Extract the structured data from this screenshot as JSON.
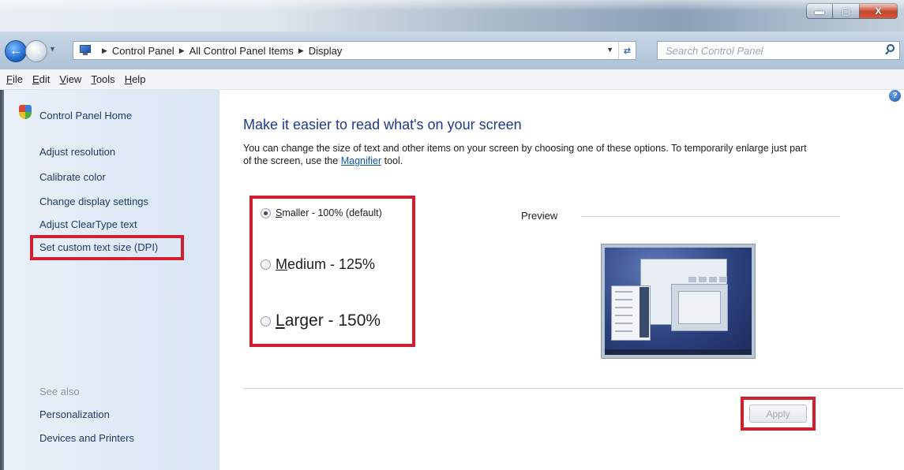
{
  "window": {
    "controls": {
      "minimize": "▬",
      "maximize": "▢",
      "close": "X"
    }
  },
  "navigation": {
    "back_icon": "back-arrow-icon",
    "forward_icon": "forward-arrow-icon",
    "breadcrumbs": [
      "Control Panel",
      "All Control Panel Items",
      "Display"
    ],
    "search_placeholder": "Search Control Panel"
  },
  "menu": [
    {
      "accel": "F",
      "rest": "ile"
    },
    {
      "accel": "E",
      "rest": "dit"
    },
    {
      "accel": "V",
      "rest": "iew"
    },
    {
      "accel": "T",
      "rest": "ools"
    },
    {
      "accel": "H",
      "rest": "elp"
    }
  ],
  "sidebar": {
    "home": "Control Panel Home",
    "links": [
      "Adjust resolution",
      "Calibrate color",
      "Change display settings",
      "Adjust ClearType text",
      "Set custom text size (DPI)"
    ],
    "see_also_title": "See also",
    "see_also": [
      "Personalization",
      "Devices and Printers"
    ]
  },
  "main": {
    "heading": "Make it easier to read what's on your screen",
    "description_before": "You can change the size of text and other items on your screen by choosing one of these options. To temporarily enlarge just part of the screen, use the ",
    "description_link": "Magnifier",
    "description_after": " tool.",
    "options": [
      {
        "accel": "S",
        "rest": "maller - 100% (default)",
        "checked": true
      },
      {
        "accel": "M",
        "rest": "edium - 125%",
        "checked": false
      },
      {
        "accel": "L",
        "rest": "arger - 150%",
        "checked": false
      }
    ],
    "preview_label": "Preview",
    "apply_label": "Apply"
  },
  "colors": {
    "highlight_box": "#d21f2f",
    "link": "#1e3c63",
    "heading": "#1e3a8a"
  }
}
